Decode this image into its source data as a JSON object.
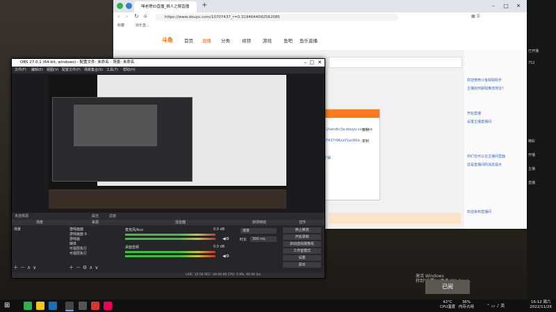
{
  "browser": {
    "tab_title": "嘿老嗯ID直播_狮人之猴直播",
    "url": "https://www.douyu.com/10707437_r=0.3194644092562085",
    "bookmarks": [
      "收藏",
      "快乐直..."
    ],
    "nav": [
      "首页",
      "直播",
      "分类",
      "视频",
      "游戏",
      "鱼吧",
      "鱼乐直播"
    ],
    "logo": "斗鱼",
    "sidebar_chat": [
      "欢迎使用斗鱼获取助手",
      "主播如何获取推流地址?",
      "开始直播",
      "设置主播直播间",
      "你们也可以在主播间里面",
      "这是直播间的消息提示",
      "欢迎来到直播间",
      "已阅"
    ],
    "dialog": {
      "title": "推流设置",
      "line1": "rtmp://sendtc3a.douyu.com/live",
      "line2": "10707437r9KsxV1ecR0e...",
      "line3": "点此了解",
      "copy": "复制"
    }
  },
  "obs": {
    "title": "OBS 27.0.1 (64-bit, windows) - 配置文件: 未命名 - 场景: 未命名",
    "menu": [
      "文件(F)",
      "编辑(E)",
      "视图(V)",
      "配置文件(P)",
      "场景集合(S)",
      "工具(T)",
      "帮助(H)"
    ],
    "status_strip": [
      "未选择源",
      "属性",
      "滤镜"
    ],
    "docks": {
      "scenes": {
        "title": "场景",
        "items": [
          "场景"
        ]
      },
      "sources": {
        "title": "来源",
        "items": [
          "游戏画面",
          "游戏画面 9",
          "游戏画",
          "媒体",
          "可视层执行",
          "可视层执行"
        ]
      },
      "mixer": {
        "title": "混音器",
        "tracks": [
          {
            "name": "桌面音频",
            "db": "0.0 dB"
          },
          {
            "name": "麦克风/Aux",
            "db": "0.0 dB"
          }
        ]
      },
      "transitions": {
        "title": "转场特效",
        "type": "渐变",
        "duration_label": "时长",
        "duration": "300 ms"
      },
      "controls": {
        "title": "控件",
        "buttons": [
          "停止推流",
          "开始录制",
          "启动虚拟摄像机",
          "工作室模式",
          "设置",
          "退出"
        ]
      }
    },
    "statusbar": "LIVE: 12:56  REC: 00:00:00  CPU: 0.9%, 60.00 fps"
  },
  "taskbar": {
    "temp": {
      "value": "42°C",
      "label": "CPU温度"
    },
    "memory": {
      "value": "36%",
      "label": "内存占用"
    },
    "time": "16:12 周六",
    "date": "2022/11/26"
  },
  "overlay": {
    "activate": "激活 Windows",
    "activate_sub": "转到\"设置\"以激活 Windows。",
    "read_button": "已阅"
  },
  "right_stream": [
    "已开播",
    "752",
    "精彩",
    "开播",
    "主播",
    "直播"
  ]
}
